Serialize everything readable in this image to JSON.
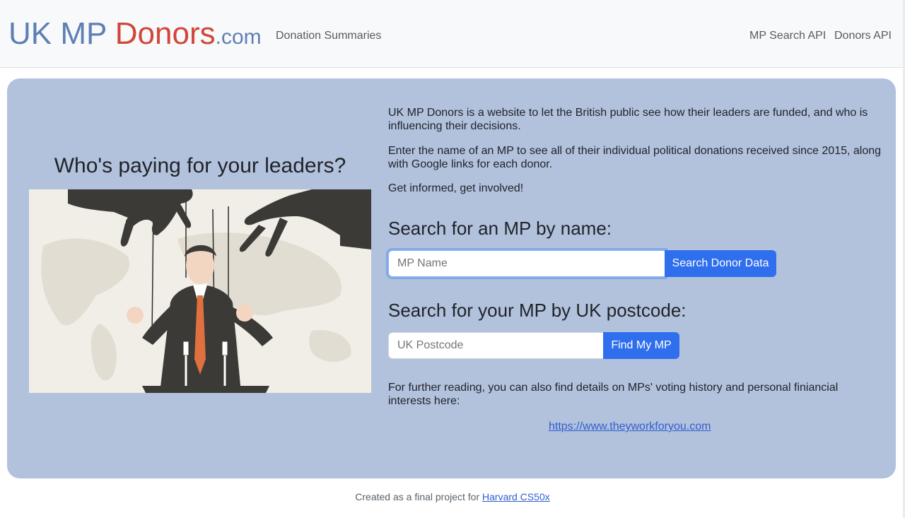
{
  "navbar": {
    "brand_part1": "UK MP ",
    "brand_part2": "Donors",
    "brand_part3": ".com",
    "links": [
      "Donation Summaries",
      "MP Search API",
      "Donors API"
    ]
  },
  "hero": {
    "title": "Who's paying for your leaders?",
    "intro": "UK MP Donors is a website to let the British public see how their leaders are funded, and who is influencing their decisions.",
    "instructions": "Enter the name of an MP to see all of their individual political donations received since 2015, along with Google links for each donor.",
    "call_to_action": "Get informed, get involved!"
  },
  "search_by_name": {
    "heading": "Search for an MP by name:",
    "placeholder": "MP Name",
    "button_label": "Search Donor Data"
  },
  "search_by_postcode": {
    "heading": "Search for your MP by UK postcode:",
    "placeholder": "UK Postcode",
    "button_label": "Find My MP"
  },
  "further_reading": {
    "text": "For further reading, you can also find details on MPs' voting history and personal finiancial interests here:",
    "link_text": "https://www.theyworkforyou.com"
  },
  "footer": {
    "text": "Created as a final project for ",
    "link_text": "Harvard CS50x"
  },
  "colors": {
    "brand_blue": "#5e7fb5",
    "brand_red": "#d0463b",
    "hero_background": "#b2c1dc",
    "button_blue": "#2f6fed"
  }
}
